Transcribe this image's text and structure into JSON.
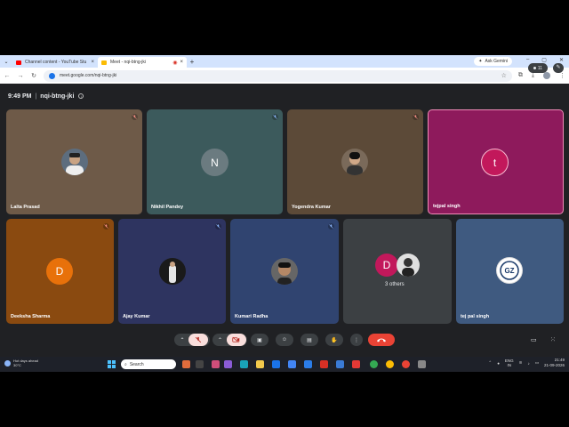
{
  "browser": {
    "tabs": [
      {
        "title": "Channel content - YouTube Stu",
        "favicon_color": "#ff0000",
        "active": false
      },
      {
        "title": "Meet - nqi-btng-jki",
        "favicon_color": "#fbbc04",
        "active": true
      }
    ],
    "ask_gemini": "Ask Gemini",
    "url": "meet.google.com/nqi-btng-jki"
  },
  "meeting": {
    "time": "9:49 PM",
    "separator": "|",
    "code": "nqi-btng-jki",
    "participants_count": "11"
  },
  "tiles": [
    {
      "name": "Lalta Prasad",
      "bg": "#6e5a48",
      "avatar": "photo",
      "avatar_bg": "#5d6d7e",
      "muted": true
    },
    {
      "name": "Nikhil Pandey",
      "bg": "#3c5a5c",
      "avatar": "N",
      "avatar_bg": "#6b7b80",
      "muted": true
    },
    {
      "name": "Yogendra Kumar",
      "bg": "#5c4a38",
      "avatar": "photo",
      "avatar_bg": "#7a6a5a",
      "muted": true
    },
    {
      "name": "tejpal singh",
      "bg": "#8e1a5c",
      "avatar": "t",
      "avatar_bg": "#c2185b",
      "muted": false
    },
    {
      "name": "Deeksha Sharma",
      "bg": "#8a4a10",
      "avatar": "D",
      "avatar_bg": "#e8710a",
      "muted": true
    },
    {
      "name": "Ajay Kumar",
      "bg": "#2e3460",
      "avatar": "photo",
      "avatar_bg": "#d9d9d9",
      "muted": true
    },
    {
      "name": "Kumari Radha",
      "bg": "#304470",
      "avatar": "photo",
      "avatar_bg": "#555",
      "muted": true
    },
    {
      "name": "3 others",
      "bg": "#3c4043",
      "avatar": "D",
      "avatar_bg": "#c2185b",
      "muted": false
    },
    {
      "name": "tej pal singh",
      "bg": "#3f5a80",
      "avatar": "logo",
      "avatar_bg": "#ffffff",
      "muted": false
    }
  ],
  "controls": {
    "mic_icon": "mic-off-icon",
    "camera_icon": "camera-off-icon",
    "hangup_icon": "call-end-icon"
  },
  "taskbar": {
    "weather_title": "Hot days ahead",
    "weather_temp": "30°C",
    "search_label": "Search",
    "lang_top": "ENG",
    "lang_bottom": "IN",
    "time": "21:49",
    "date": "21-09-2026"
  },
  "colors": {
    "meet_bg": "#202124",
    "button_bg": "#3c4043",
    "hangup": "#ea4335"
  }
}
